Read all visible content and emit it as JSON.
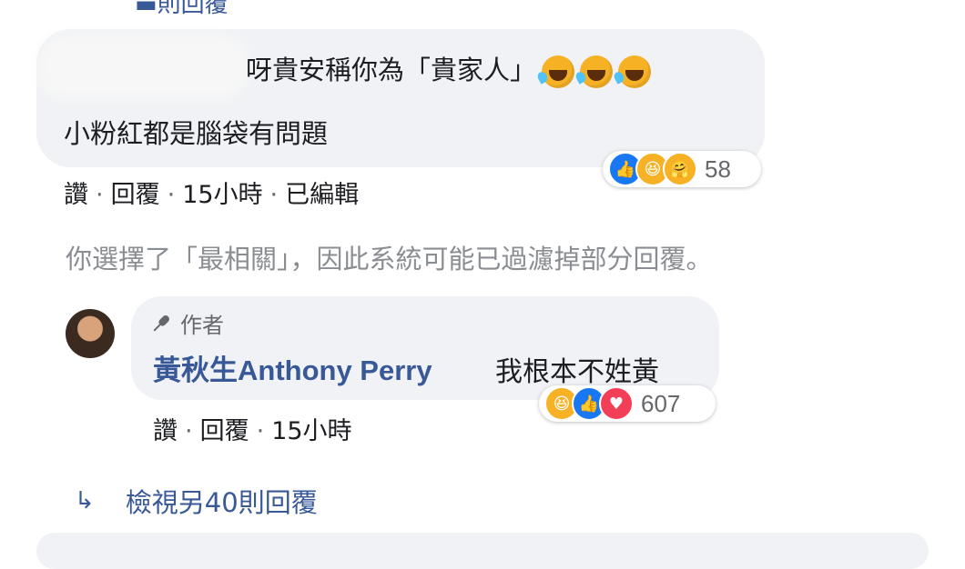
{
  "top": {
    "reply_link": "則回覆"
  },
  "comment1": {
    "line1_text": "呀貴安稱你為「貴家人」",
    "line1_emojis": [
      "rolling-laughing-emoji",
      "rolling-laughing-emoji",
      "rolling-laughing-emoji"
    ],
    "line2_text": "小粉紅都是腦袋有問題",
    "reactions": {
      "icons": [
        "like-reaction-icon",
        "haha-reaction-icon",
        "care-reaction-icon"
      ],
      "count": "58"
    },
    "actions": {
      "like": "讚",
      "reply": "回覆",
      "time": "15小時",
      "edited": "已編輯"
    }
  },
  "filter_notice": "你選擇了「最相關」，因此系統可能已過濾掉部分回覆。",
  "author_comment": {
    "badge": "作者",
    "name": "黃秋生Anthony Perry",
    "text": "我根本不姓黃",
    "reactions": {
      "icons": [
        "haha-reaction-icon",
        "like-reaction-icon",
        "love-reaction-icon"
      ],
      "count": "607"
    },
    "actions": {
      "like": "讚",
      "reply": "回覆",
      "time": "15小時"
    }
  },
  "view_more": {
    "icon": "reply-arrow-icon",
    "label": "檢視另40則回覆"
  },
  "colors": {
    "bubble": "#f0f2f5",
    "link": "#385898",
    "meta": "#65676b",
    "like": "#1877f2",
    "love": "#f33e58",
    "haha": "#f7b125"
  }
}
